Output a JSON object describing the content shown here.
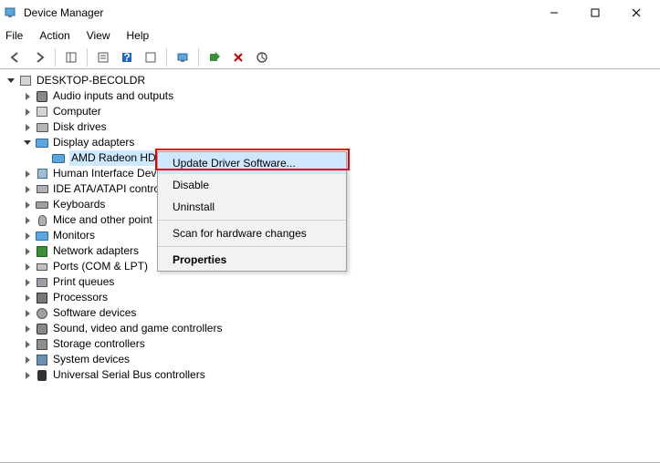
{
  "titlebar": {
    "title": "Device Manager"
  },
  "menubar": {
    "file": "File",
    "action": "Action",
    "view": "View",
    "help": "Help"
  },
  "tree": {
    "root": "DESKTOP-BECOLDR",
    "items": [
      {
        "label": "Audio inputs and outputs",
        "icon": "sound"
      },
      {
        "label": "Computer",
        "icon": "pc"
      },
      {
        "label": "Disk drives",
        "icon": "disk"
      },
      {
        "label": "Display adapters",
        "icon": "monitor",
        "expanded": true,
        "children": [
          {
            "label": "AMD Radeon HD",
            "icon": "monitor",
            "selected": true
          }
        ]
      },
      {
        "label": "Human Interface Dev",
        "icon": "hid",
        "truncated": true
      },
      {
        "label": "IDE ATA/ATAPI contro",
        "icon": "ide",
        "truncated": true
      },
      {
        "label": "Keyboards",
        "icon": "keyboard"
      },
      {
        "label": "Mice and other point",
        "icon": "mouse",
        "truncated": true
      },
      {
        "label": "Monitors",
        "icon": "monitor"
      },
      {
        "label": "Network adapters",
        "icon": "net"
      },
      {
        "label": "Ports (COM & LPT)",
        "icon": "port"
      },
      {
        "label": "Print queues",
        "icon": "printer"
      },
      {
        "label": "Processors",
        "icon": "cpu"
      },
      {
        "label": "Software devices",
        "icon": "gear"
      },
      {
        "label": "Sound, video and game controllers",
        "icon": "sound"
      },
      {
        "label": "Storage controllers",
        "icon": "stor"
      },
      {
        "label": "System devices",
        "icon": "sys"
      },
      {
        "label": "Universal Serial Bus controllers",
        "icon": "usb"
      }
    ]
  },
  "context_menu": {
    "update": "Update Driver Software...",
    "disable": "Disable",
    "uninstall": "Uninstall",
    "scan": "Scan for hardware changes",
    "properties": "Properties"
  }
}
